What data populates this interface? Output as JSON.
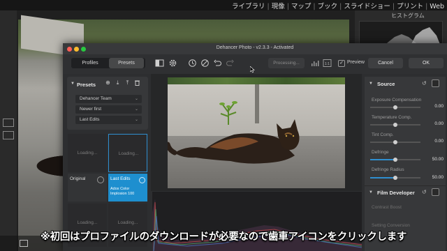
{
  "lightroom": {
    "modules": [
      "ライブラリ",
      "現像",
      "マップ",
      "ブック",
      "スライドショー",
      "プリント",
      "Web"
    ],
    "histogram_label": "ヒストグラム"
  },
  "dehancer": {
    "title": "Dehancer Photo - v2.3.3 - Activated",
    "tabs": [
      "Profiles",
      "Presets"
    ],
    "active_tab": "Presets",
    "processing_label": "Processing...",
    "preview_label": "Preview",
    "preview_checked": true,
    "cancel_label": "Cancel",
    "ok_label": "OK",
    "presets_panel": {
      "title": "Presets",
      "dropdowns": [
        "Dehancer Team",
        "Newer first",
        "Last Edits"
      ]
    },
    "thumbnails": [
      {
        "label": "Loading..."
      },
      {
        "label": "Loading..."
      },
      {
        "label": "Original"
      },
      {
        "label": "Last Edits",
        "sublabel": "Adox Color Implosion 100"
      },
      {
        "label": "Loading..."
      },
      {
        "label": "Loading..."
      }
    ],
    "source_panel": {
      "title": "Source",
      "controls": [
        {
          "label": "Exposure Compensation",
          "value": "0.00",
          "position": 0.5
        },
        {
          "label": "Temperature Comp.",
          "value": "0.00",
          "position": 0.5
        },
        {
          "label": "Tint Comp.",
          "value": "0.00",
          "position": 0.5
        },
        {
          "label": "Defringe",
          "value": "50.00",
          "position": 0.5
        },
        {
          "label": "Defringe Radius",
          "value": "50.00",
          "position": 0.5
        }
      ]
    },
    "film_panel": {
      "title": "Film Developer",
      "controls": [
        "Contrast Boost",
        "Setting Conversion"
      ]
    }
  },
  "caption": "※初回はプロファイルのダウンロードが必要なので歯車アイコンをクリックします",
  "colors": {
    "accent": "#1e8fcf",
    "window_bg": "#2d2e30"
  }
}
